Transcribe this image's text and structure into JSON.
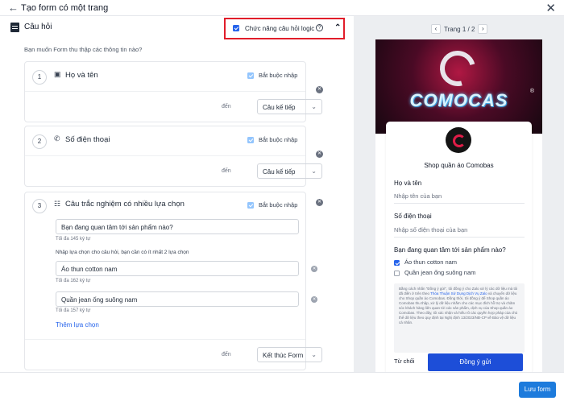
{
  "header": {
    "title": "Tạo form có một trang"
  },
  "section": {
    "title": "Câu hỏi",
    "logic_label": "Chức năng câu hỏi logic",
    "intro": "Bạn muốn Form thu thập các thông tin nào?"
  },
  "questions": [
    {
      "number": "1",
      "icon": "contact-card-icon",
      "label": "Họ và tên",
      "required_label": "Bắt buộc nhập",
      "required": true,
      "den": "đến",
      "next": "Câu kế tiếp"
    },
    {
      "number": "2",
      "icon": "phone-icon",
      "label": "Số điện thoại",
      "required_label": "Bắt buộc nhập",
      "required": true,
      "den": "đến",
      "next": "Câu kế tiếp"
    },
    {
      "number": "3",
      "icon": "multiple-choice-icon",
      "label": "Câu trắc nghiệm có nhiều lựa chọn",
      "required_label": "Bắt buộc nhập",
      "required": true,
      "question_text": "Bạn đang quan tâm tới sản phẩm nào?",
      "question_hint": "Tối đa 145 ký tự",
      "options_instruction": "Nhập lựa chọn cho câu hỏi, bạn cần có ít nhất 2 lựa chọn",
      "options": [
        {
          "value": "Áo thun cotton nam",
          "hint": "Tối đa 162 ký tự"
        },
        {
          "value": "Quần jean ống suông nam",
          "hint": "Tối đa 157 ký tự"
        }
      ],
      "add_option": "Thêm lựa chọn",
      "den": "đến",
      "next": "Kết thúc Form"
    }
  ],
  "preview": {
    "page_indicator": "Trang 1 / 2",
    "brand": "COMOCAS",
    "shop_name": "Shop quần áo Comobas",
    "fields": [
      {
        "label": "Họ và tên",
        "placeholder": "Nhập tên của bạn"
      },
      {
        "label": "Số điện thoại",
        "placeholder": "Nhập số điện thoại của bạn"
      }
    ],
    "question": "Bạn đang quan tâm tới sản phẩm nào?",
    "options": [
      {
        "label": "Áo thun cotton nam",
        "checked": true
      },
      {
        "label": "Quần jean ống suông nam",
        "checked": false
      }
    ],
    "consent_text": "Bằng cách nhấn \"Đồng ý gửi\", tôi đồng ý cho Zalo xử lý các dữ liệu mà tôi đã điền ở trên theo",
    "consent_link": "Thỏa Thuận Sử Dụng Dịch Vụ Zalo",
    "consent_rest": "và chuyển dữ liệu cho Shop quần áo Comobas. Đồng thời, tôi đồng ý để Shop quần áo Comobas thu thập, xử lý dữ liệu nhằm cho các mục đích hỗ trợ và chăm sóc khách hàng liên quan tới các sản phẩm, dịch vụ của Shop quần áo Comobas. Theo đây, tôi xác nhận và hiểu rõ các quyền hợp pháp của chủ thể dữ liệu theo quy định tại Nghị định 13/2023/NĐ-CP về Bảo vệ dữ liệu cá nhân.",
    "decline": "Từ chối",
    "agree": "Đồng ý gửi"
  },
  "footer": {
    "save": "Lưu form"
  },
  "colors": {
    "accent": "#2563eb",
    "highlight_border": "#e11d2a",
    "save_button": "#1d7bdc"
  }
}
